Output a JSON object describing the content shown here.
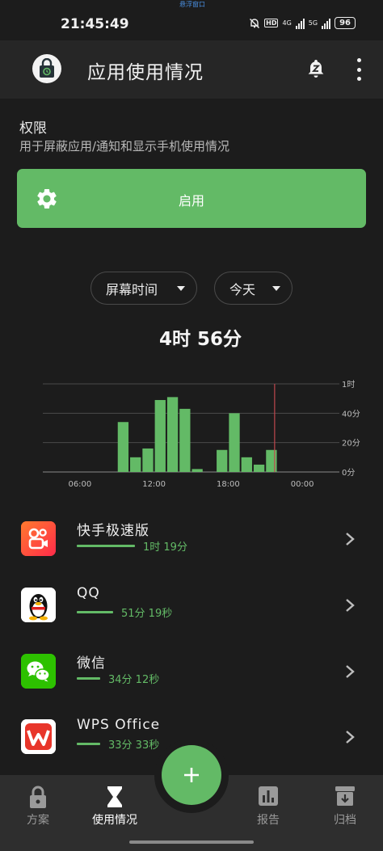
{
  "status_bar": {
    "time": "21:45:49",
    "tiny_label": "悬浮窗口",
    "network_hd": "HD",
    "network_4g": "4G",
    "network_5g": "5G",
    "battery": "96"
  },
  "app_bar": {
    "title": "应用使用情况",
    "snooze_icon": "snooze-bell-icon",
    "more_icon": "more-vert-icon"
  },
  "permission": {
    "title": "权限",
    "description": "用于屏蔽应用/通知和显示手机使用情况",
    "enable_label": "启用"
  },
  "filters": {
    "metric": "屏幕时间",
    "period": "今天"
  },
  "total_time": "4时 56分",
  "chart_data": {
    "type": "bar",
    "x_tick_labels": [
      "06:00",
      "12:00",
      "18:00",
      "00:00"
    ],
    "y_tick_labels": [
      "1时",
      "40分",
      "20分",
      "0分"
    ],
    "ylim_minutes": [
      0,
      60
    ],
    "hour_slots_start": 3,
    "values_minutes": [
      0,
      0,
      0,
      0,
      0,
      0,
      34,
      10,
      16,
      49,
      51,
      43,
      2,
      0,
      15,
      40,
      10,
      5,
      15,
      0,
      0,
      0,
      0,
      0
    ],
    "current_time_hour": 21.76,
    "bar_color": "#63ba66",
    "marker_color": "#c0474e"
  },
  "apps": [
    {
      "name": "快手极速版",
      "usage": "1时 19分",
      "icon": "kuaishou-icon",
      "bar_fraction": 0.27
    },
    {
      "name": "QQ",
      "usage": "51分 19秒",
      "icon": "qq-penguin-icon",
      "bar_fraction": 0.17
    },
    {
      "name": "微信",
      "usage": "34分 12秒",
      "icon": "wechat-icon",
      "bar_fraction": 0.11
    },
    {
      "name": "WPS Office",
      "usage": "33分 33秒",
      "icon": "wps-office-icon",
      "bar_fraction": 0.11
    }
  ],
  "bottom_nav": {
    "items": [
      {
        "label": "方案",
        "icon": "lock-icon",
        "active": false
      },
      {
        "label": "使用情况",
        "icon": "hourglass-icon",
        "active": true
      },
      {
        "label": "报告",
        "icon": "bar-chart-icon",
        "active": false
      },
      {
        "label": "归档",
        "icon": "archive-icon",
        "active": false
      }
    ],
    "fab_icon": "plus-icon"
  },
  "colors": {
    "accent": "#63ba66",
    "background": "#1c1c1c",
    "app_bar": "#262626",
    "bottom_nav": "#2e2e2e"
  }
}
